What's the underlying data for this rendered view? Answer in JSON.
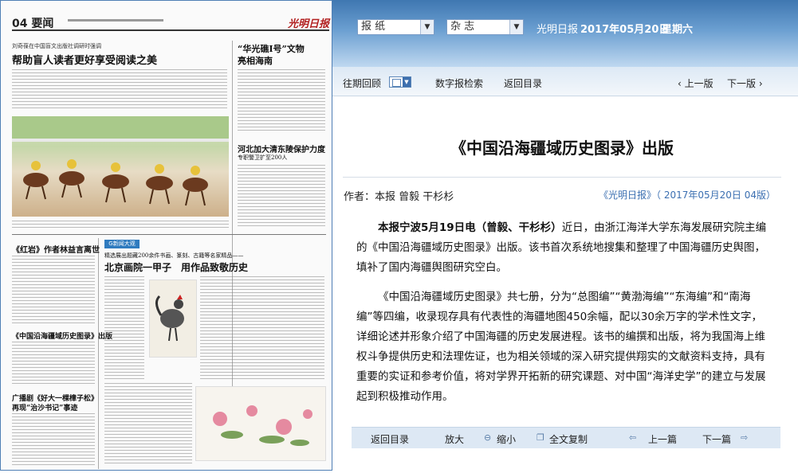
{
  "paper": {
    "page_number": "04",
    "section": "要闻",
    "masthead": "光明日报",
    "headline_1_kicker": "刘奇葆在中国盲文出版社调研时强调",
    "headline_1": "帮助盲人读者更好享受阅读之美",
    "headline_2a": "“华光礁Ⅰ号”文物",
    "headline_2b": "亮相海南",
    "headline_3": "河北加大清东陵保护力度",
    "headline_3_sub": "专职警卫扩至200人",
    "headline_4": "《红岩》作者林益言离世",
    "headline_5_kicker": "精选展出题藏200余件书画、篆刻、古籍等名家精品——",
    "headline_5": "北京画院一甲子　用作品致敬历史",
    "headline_6": "《中国沿海疆域历史图录》出版",
    "headline_7a": "广播剧《好大一棵樟子松》",
    "headline_7b": "再现“治沙书记”事迹",
    "badge": "G新闻大观"
  },
  "header": {
    "select_newspaper": "报 纸",
    "select_magazine": "杂 志",
    "paper_name": "光明日报",
    "date": "2017年05月20日",
    "weekday": "星期六"
  },
  "nav": {
    "past_review": "往期回顾",
    "digital_search": "数字报检索",
    "back_to_index": "返回目录",
    "prev_page": "上一版",
    "next_page": "下一版"
  },
  "article": {
    "title": "《中国沿海疆域历史图录》出版",
    "author": "作者：本报  曾毅  干杉杉",
    "source": "《光明日报》（ 2017年05月20日 04版）",
    "lead_bold": "本报宁波5月19日电（曾毅、干杉杉）",
    "para1_rest": "近日，由浙江海洋大学东海发展研究院主编的《中国沿海疆域历史图录》出版。该书首次系统地搜集和整理了中国海疆历史舆图，填补了国内海疆舆图研究空白。",
    "para2": "《中国沿海疆域历史图录》共七册，分为“总图编”“黄渤海编”“东海编”和“南海编”等四编，收录现存具有代表性的海疆地图450余幅，配以30余万字的学术性文字，详细论述并形象介绍了中国海疆的历史发展进程。该书的编撰和出版，将为我国海上维权斗争提供历史和法理佐证，也为相关领域的深入研究提供翔实的文献资料支持，具有重要的实证和参考价值，将对学界开拓新的研究课题、对中国“海洋史学”的建立与发展起到积极推动作用。"
  },
  "toolbar": {
    "back_to_index": "返回目录",
    "zoom_in": "放大",
    "zoom_out": "缩小",
    "copy_full": "全文复制",
    "prev_article": "上一篇",
    "next_article": "下一篇"
  }
}
